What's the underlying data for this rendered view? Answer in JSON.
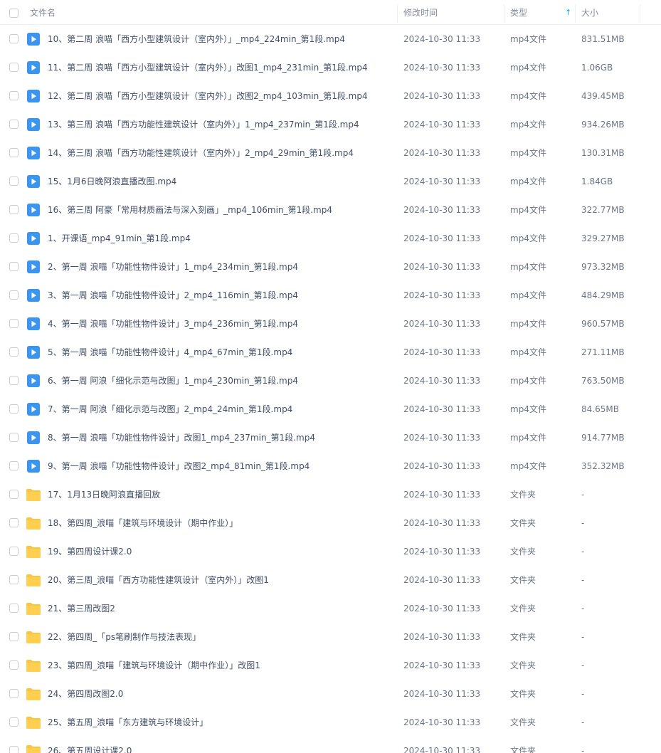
{
  "header": {
    "name": "文件名",
    "modified": "修改时间",
    "type": "类型",
    "size": "大小",
    "sort_indicator": "↑"
  },
  "colors": {
    "video_icon": "#3b95ee",
    "folder_icon": "#ffc43d",
    "sort_accent": "#06a7ff"
  },
  "files": [
    {
      "icon": "video-icon",
      "name": "10、第二周 浪喵「西方小型建筑设计（室内外）」_mp4_224min_第1段.mp4",
      "modified": "2024-10-30 11:33",
      "type": "mp4文件",
      "size": "831.51MB"
    },
    {
      "icon": "video-icon",
      "name": "11、第二周 浪喵「西方小型建筑设计（室内外）」改图1_mp4_231min_第1段.mp4",
      "modified": "2024-10-30 11:33",
      "type": "mp4文件",
      "size": "1.06GB"
    },
    {
      "icon": "video-icon",
      "name": "12、第二周 浪喵「西方小型建筑设计（室内外）」改图2_mp4_103min_第1段.mp4",
      "modified": "2024-10-30 11:33",
      "type": "mp4文件",
      "size": "439.45MB"
    },
    {
      "icon": "video-icon",
      "name": "13、第三周 浪喵「西方功能性建筑设计（室内外）」1_mp4_237min_第1段.mp4",
      "modified": "2024-10-30 11:33",
      "type": "mp4文件",
      "size": "934.26MB"
    },
    {
      "icon": "video-icon",
      "name": "14、第三周 浪喵「西方功能性建筑设计（室内外）」2_mp4_29min_第1段.mp4",
      "modified": "2024-10-30 11:33",
      "type": "mp4文件",
      "size": "130.31MB"
    },
    {
      "icon": "video-icon",
      "name": "15、1月6日晚阿浪直播改图.mp4",
      "modified": "2024-10-30 11:33",
      "type": "mp4文件",
      "size": "1.84GB"
    },
    {
      "icon": "video-icon",
      "name": "16、第三周  阿豪「常用材质画法与深入刻画」_mp4_106min_第1段.mp4",
      "modified": "2024-10-30 11:33",
      "type": "mp4文件",
      "size": "322.77MB"
    },
    {
      "icon": "video-icon",
      "name": "1、开课语_mp4_91min_第1段.mp4",
      "modified": "2024-10-30 11:33",
      "type": "mp4文件",
      "size": "329.27MB"
    },
    {
      "icon": "video-icon",
      "name": "2、第一周 浪喵「功能性物件设计」1_mp4_234min_第1段.mp4",
      "modified": "2024-10-30 11:33",
      "type": "mp4文件",
      "size": "973.32MB"
    },
    {
      "icon": "video-icon",
      "name": "3、第一周 浪喵「功能性物件设计」2_mp4_116min_第1段.mp4",
      "modified": "2024-10-30 11:33",
      "type": "mp4文件",
      "size": "484.29MB"
    },
    {
      "icon": "video-icon",
      "name": "4、第一周 浪喵「功能性物件设计」3_mp4_236min_第1段.mp4",
      "modified": "2024-10-30 11:33",
      "type": "mp4文件",
      "size": "960.57MB"
    },
    {
      "icon": "video-icon",
      "name": "5、第一周 浪喵「功能性物件设计」4_mp4_67min_第1段.mp4",
      "modified": "2024-10-30 11:33",
      "type": "mp4文件",
      "size": "271.11MB"
    },
    {
      "icon": "video-icon",
      "name": "6、第一周 阿浪「细化示范与改图」1_mp4_230min_第1段.mp4",
      "modified": "2024-10-30 11:33",
      "type": "mp4文件",
      "size": "763.50MB"
    },
    {
      "icon": "video-icon",
      "name": "7、第一周 阿浪「细化示范与改图」2_mp4_24min_第1段.mp4",
      "modified": "2024-10-30 11:33",
      "type": "mp4文件",
      "size": "84.65MB"
    },
    {
      "icon": "video-icon",
      "name": "8、第一周 浪喵「功能性物件设计」改图1_mp4_237min_第1段.mp4",
      "modified": "2024-10-30 11:33",
      "type": "mp4文件",
      "size": "914.77MB"
    },
    {
      "icon": "video-icon",
      "name": "9、第一周 浪喵「功能性物件设计」改图2_mp4_81min_第1段.mp4",
      "modified": "2024-10-30 11:33",
      "type": "mp4文件",
      "size": "352.32MB"
    },
    {
      "icon": "folder-icon",
      "name": "17、1月13日晚阿浪直播回放",
      "modified": "2024-10-30 11:33",
      "type": "文件夹",
      "size": "-"
    },
    {
      "icon": "folder-icon",
      "name": "18、第四周_浪喵「建筑与环境设计（期中作业）」",
      "modified": "2024-10-30 11:33",
      "type": "文件夹",
      "size": "-"
    },
    {
      "icon": "folder-icon",
      "name": "19、第四周设计课2.0",
      "modified": "2024-10-30 11:33",
      "type": "文件夹",
      "size": "-"
    },
    {
      "icon": "folder-icon",
      "name": "20、第三周_浪喵「西方功能性建筑设计（室内外）」改图1",
      "modified": "2024-10-30 11:33",
      "type": "文件夹",
      "size": "-"
    },
    {
      "icon": "folder-icon",
      "name": "21、第三周改图2",
      "modified": "2024-10-30 11:33",
      "type": "文件夹",
      "size": "-"
    },
    {
      "icon": "folder-icon",
      "name": "22、第四周_「ps笔刷制作与技法表现」",
      "modified": "2024-10-30 11:33",
      "type": "文件夹",
      "size": "-"
    },
    {
      "icon": "folder-icon",
      "name": "23、第四周_浪喵「建筑与环境设计（期中作业）」改图1",
      "modified": "2024-10-30 11:33",
      "type": "文件夹",
      "size": "-"
    },
    {
      "icon": "folder-icon",
      "name": "24、第四周改图2.0",
      "modified": "2024-10-30 11:33",
      "type": "文件夹",
      "size": "-"
    },
    {
      "icon": "folder-icon",
      "name": "25、第五周_浪喵「东方建筑与环境设计」",
      "modified": "2024-10-30 11:33",
      "type": "文件夹",
      "size": "-"
    },
    {
      "icon": "folder-icon",
      "name": "26、第五周设计课2.0",
      "modified": "2024-10-30 11:33",
      "type": "文件夹",
      "size": "-"
    }
  ]
}
